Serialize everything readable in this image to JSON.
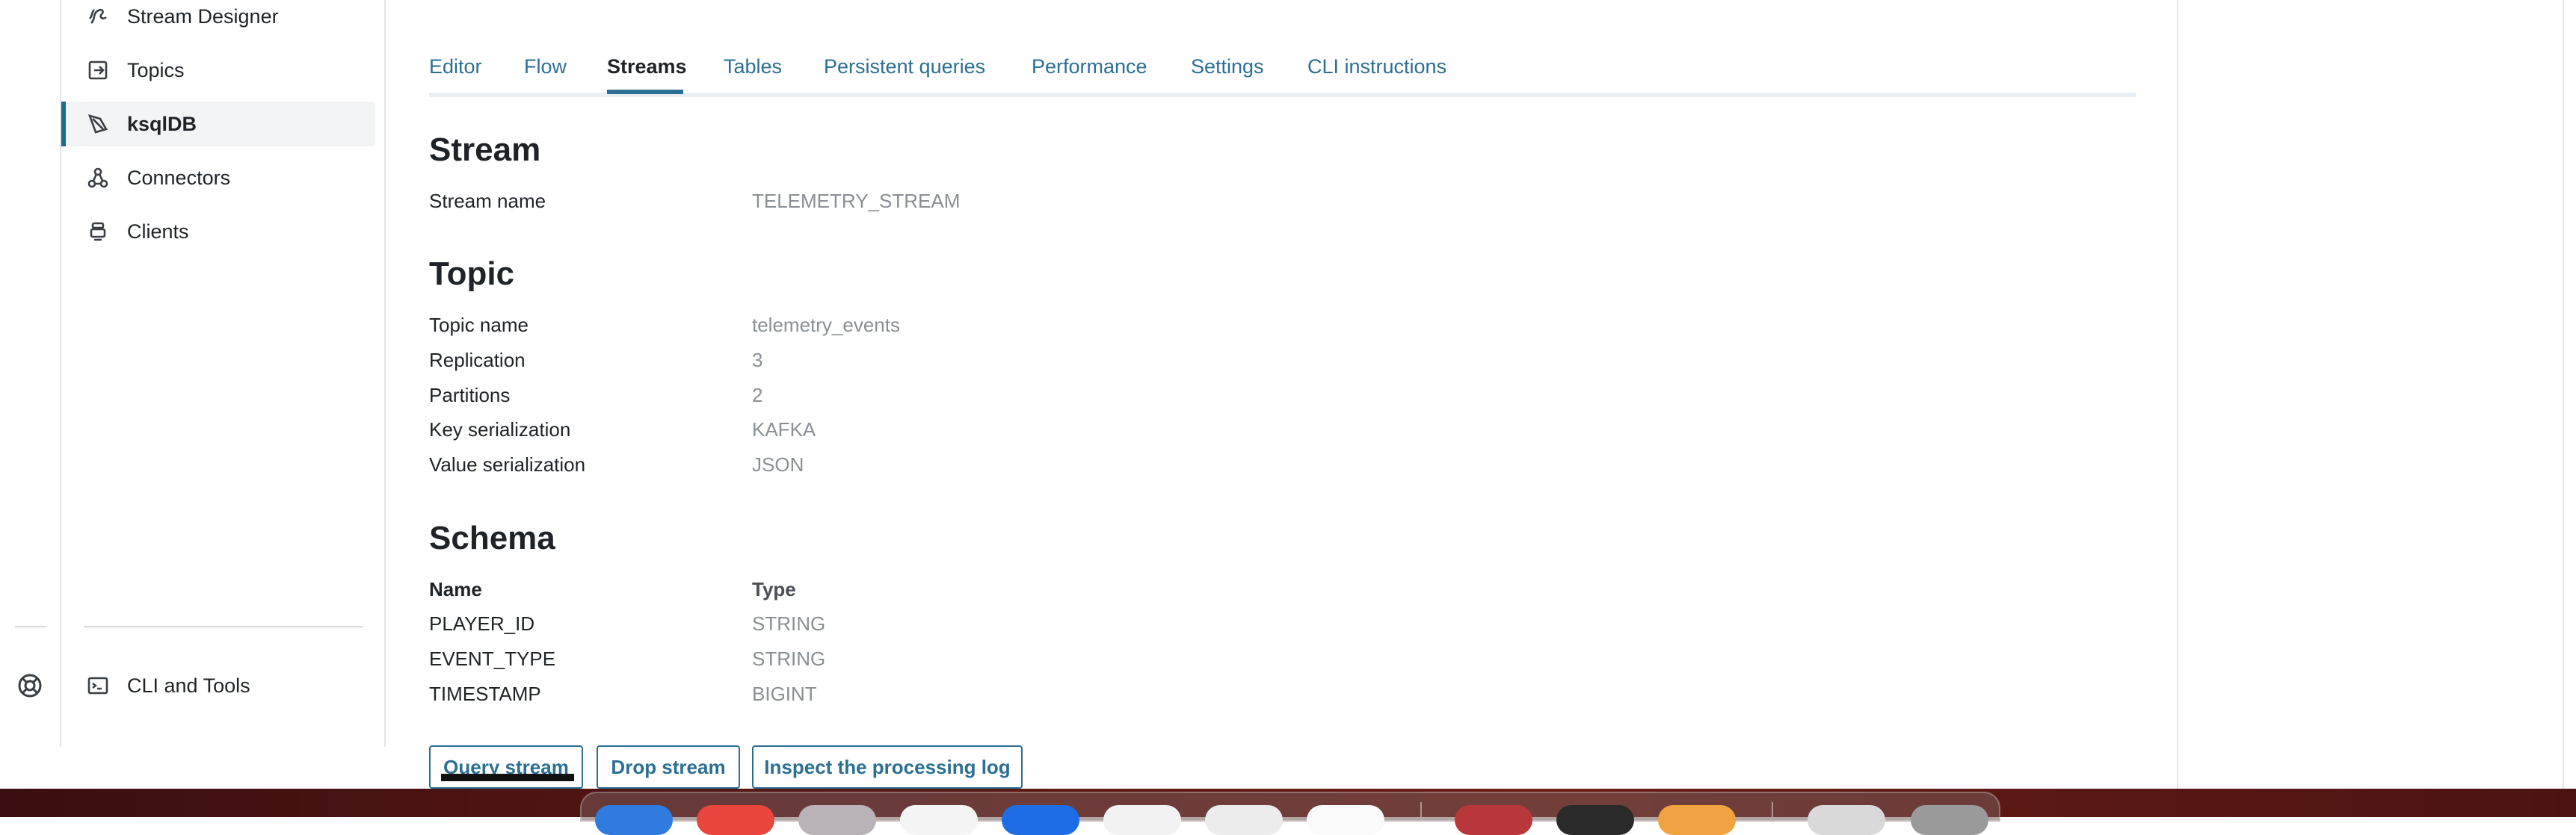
{
  "sidebar": {
    "items": [
      {
        "label": "Stream Designer",
        "icon": "stream-designer-icon"
      },
      {
        "label": "Topics",
        "icon": "topics-icon"
      },
      {
        "label": "ksqlDB",
        "icon": "ksqldb-icon",
        "active": true
      },
      {
        "label": "Connectors",
        "icon": "connectors-icon"
      },
      {
        "label": "Clients",
        "icon": "clients-icon"
      }
    ],
    "bottom": {
      "label": "CLI and Tools",
      "icon": "terminal-icon"
    }
  },
  "tabs": [
    {
      "label": "Editor"
    },
    {
      "label": "Flow"
    },
    {
      "label": "Streams",
      "active": true
    },
    {
      "label": "Tables"
    },
    {
      "label": "Persistent queries"
    },
    {
      "label": "Performance"
    },
    {
      "label": "Settings"
    },
    {
      "label": "CLI instructions"
    }
  ],
  "stream": {
    "heading": "Stream",
    "name_label": "Stream name",
    "name_value": "TELEMETRY_STREAM"
  },
  "topic": {
    "heading": "Topic",
    "rows": [
      {
        "label": "Topic name",
        "value": "telemetry_events"
      },
      {
        "label": "Replication",
        "value": "3"
      },
      {
        "label": "Partitions",
        "value": "2"
      },
      {
        "label": "Key serialization",
        "value": "KAFKA"
      },
      {
        "label": "Value serialization",
        "value": "JSON"
      }
    ]
  },
  "schema": {
    "heading": "Schema",
    "col_name": "Name",
    "col_type": "Type",
    "rows": [
      {
        "name": "PLAYER_ID",
        "type": "STRING"
      },
      {
        "name": "EVENT_TYPE",
        "type": "STRING"
      },
      {
        "name": "TIMESTAMP",
        "type": "BIGINT"
      }
    ]
  },
  "actions": {
    "query": "Query stream",
    "drop": "Drop stream",
    "inspect": "Inspect the processing log"
  },
  "colors": {
    "accent": "#2b6f93",
    "active_indicator": "#1f6b8a",
    "muted_text": "#8a8f96"
  }
}
